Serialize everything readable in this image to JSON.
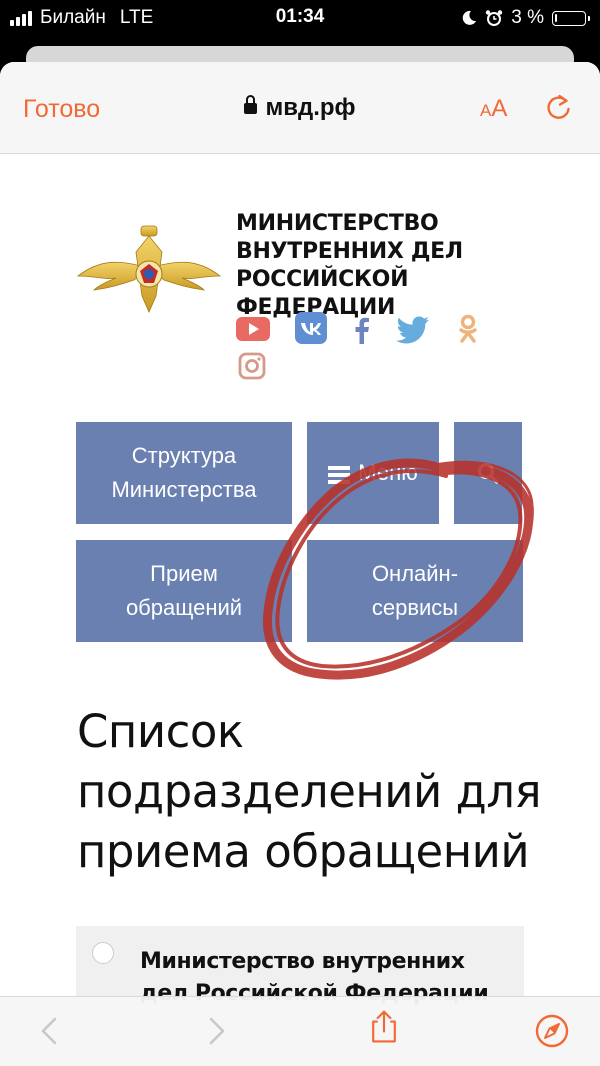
{
  "status_bar": {
    "carrier": "Билайн",
    "network": "LTE",
    "time": "01:34",
    "battery": "3 %"
  },
  "browser": {
    "done_label": "Готово",
    "url": "мвд.рф",
    "text_size_label_small": "A",
    "text_size_label_large": "A",
    "accent_color": "#f06a36"
  },
  "header": {
    "org_title": "МИНИСТЕРСТВО ВНУТРЕННИХ ДЕЛ РОССИЙСКОЙ ФЕДЕРАЦИИ",
    "social_icons": [
      "youtube-icon",
      "vk-icon",
      "facebook-icon",
      "twitter-icon",
      "odnoklassniki-icon",
      "instagram-icon"
    ]
  },
  "nav": {
    "tile_color": "#6a80b1",
    "structure_label": "Структура\nМинистерства",
    "menu_label": "Меню",
    "reception_label": "Прием\nобращений",
    "online_label": "Онлайн-\nсервисы"
  },
  "main": {
    "heading": "Список подразделений для приема обращений",
    "list_item": "Министерство внутренних дел Российской Федерации"
  },
  "annotation": {
    "scribble_color": "#b8322a"
  }
}
